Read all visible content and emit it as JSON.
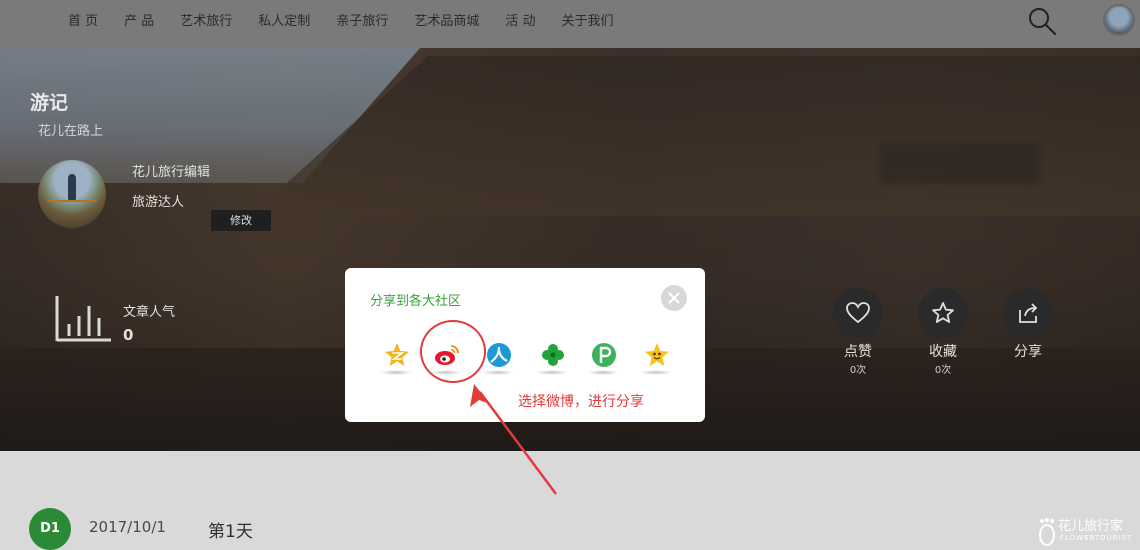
{
  "nav": {
    "items": [
      "首 页",
      "产 品",
      "艺术旅行",
      "私人定制",
      "亲子旅行",
      "艺术品商城",
      "活 动",
      "关于我们"
    ]
  },
  "hero": {
    "title": "游记",
    "subtitle": "花儿在路上",
    "author_name": "花儿旅行编辑",
    "author_level": "旅游达人",
    "edit_label": "修改",
    "popularity_label": "文章人气",
    "popularity_value": "0"
  },
  "actions": {
    "like": {
      "label": "点赞",
      "count": "0次"
    },
    "favorite": {
      "label": "收藏",
      "count": "0次"
    },
    "share": {
      "label": "分享"
    }
  },
  "share_modal": {
    "title": "分享到各大社区",
    "targets": [
      "qzone-icon",
      "weibo-icon",
      "renren-icon",
      "kaixin-icon",
      "pengyou-icon",
      "qq-icon"
    ],
    "annotation": "选择微博，进行分享"
  },
  "day": {
    "badge": "D1",
    "date": "2017/10/1",
    "label": "第1天"
  },
  "watermark": {
    "text": "花儿旅行家",
    "sub": "FLOWERTOURIST"
  },
  "colors": {
    "accent_green": "#37a23c",
    "annotation_red": "#e23b3b",
    "badge_green": "#2b8a35"
  }
}
